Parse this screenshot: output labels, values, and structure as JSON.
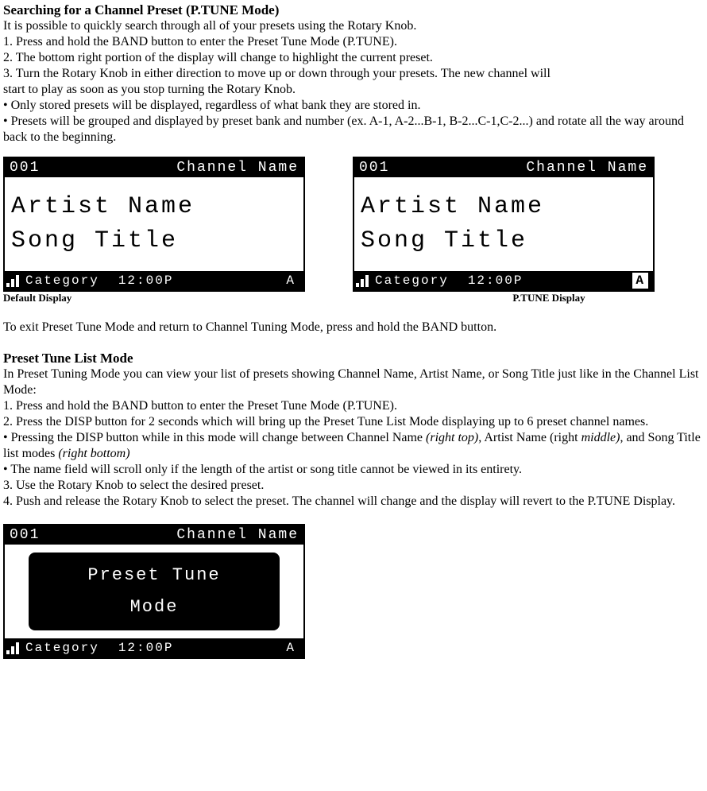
{
  "section1": {
    "heading": "Searching for a Channel Preset (P.TUNE Mode)",
    "intro": "It is possible to quickly search through all of your presets using the Rotary Knob.",
    "step1": "1. Press and hold the BAND button to enter the Preset Tune Mode (P.TUNE).",
    "step2": "2. The bottom right portion of the display will change to highlight the current preset.",
    "step3a": "3. Turn the Rotary Knob in either direction to move up or down through your presets. The new channel will",
    "step3b": "start to play as soon as you stop turning the Rotary Knob.",
    "bullet1": "• Only stored presets will be displayed, regardless of what bank they are stored in.",
    "bullet2": "• Presets will be grouped and displayed by preset bank and number (ex. A-1, A-2...B-1, B-2...C-1,C-2...) and rotate all the way around back to the beginning.",
    "exit": "To exit Preset Tune Mode and return to Channel Tuning Mode, press and hold the BAND button."
  },
  "captions": {
    "default": "Default Display",
    "ptune": "P.TUNE Display"
  },
  "lcd": {
    "ch": "001",
    "chname": "Channel Name",
    "artist": "Artist Name",
    "song": "Song Title",
    "category": "Category",
    "time": "12:00P",
    "slot": "A",
    "overlay1": "Preset Tune",
    "overlay2": "Mode"
  },
  "section2": {
    "heading": "Preset Tune List Mode",
    "intro": "In Preset Tuning Mode you can view your list of presets showing Channel Name, Artist Name, or Song Title just like in the Channel List Mode:",
    "step1": "1. Press and hold the BAND button to enter the Preset Tune Mode (P.TUNE).",
    "step2": "2. Press the DISP button for 2 seconds which will bring up the Preset Tune List Mode displaying up to 6 preset channel names.",
    "bullet1a": "• Pressing the DISP button while in this mode will change between Channel Name ",
    "bullet1b": "(right top)",
    "bullet1c": ", Artist Name (right ",
    "bullet1d": "middle)",
    "bullet1e": ", and Song Title list modes ",
    "bullet1f": "(right bottom)",
    "bullet2": "• The name field will scroll only if the length of the artist or song title cannot be viewed in its entirety.",
    "step3": "3. Use the Rotary Knob to select the desired preset.",
    "step4": "4. Push and release the Rotary Knob to select the preset. The channel will change and the display will revert to the P.TUNE Display."
  }
}
